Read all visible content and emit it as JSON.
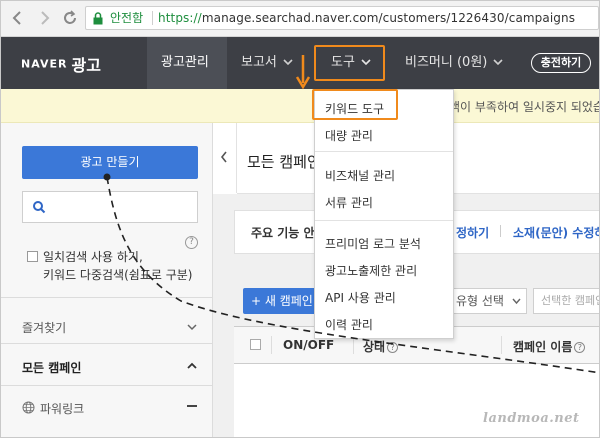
{
  "browser": {
    "security_label": "안전함",
    "url_scheme": "https://",
    "url_rest": "manage.searchad.naver.com/customers/1226430/campaigns",
    "icons": [
      "back-icon",
      "forward-icon",
      "refresh-icon",
      "lock-icon"
    ]
  },
  "topnav": {
    "logo_brand": "NAVER",
    "logo_service": "광고",
    "menu": [
      {
        "label": "광고관리"
      },
      {
        "label": "보고서"
      },
      {
        "label": "도구"
      },
      {
        "label": "비즈머니 (0원)"
      }
    ],
    "charge_button": "충전하기",
    "accent_color": "#f08a1c"
  },
  "notice": {
    "text": "액이 부족하여 일시중지 되었습"
  },
  "tools_menu": {
    "items": [
      {
        "label": "키워드 도구"
      },
      {
        "label": "대량 관리"
      },
      {
        "label": "비즈채널 관리"
      },
      {
        "label": "서류 관리"
      },
      {
        "label": "프리미엄 로그 분석"
      },
      {
        "label": "광고노출제한 관리"
      },
      {
        "label": "API 사용 관리"
      },
      {
        "label": "이력 관리"
      }
    ]
  },
  "sidebar": {
    "create_button": "광고 만들기",
    "search_placeholder": "",
    "exact_match_line1": "일치검색 사용 하기,",
    "exact_match_line2": "키워드 다중검색(쉼표로 구분)",
    "help": "?",
    "favorites": "즐겨찾기",
    "all_campaigns": "모든 캠페인",
    "powerlink": "파워링크"
  },
  "main": {
    "title": "모든 캠페인",
    "func_title": "주요 기능 안",
    "func_link1": "정하기",
    "func_link2": "소재(문안) 수정하",
    "new_campaign": "+ 새 캠페인",
    "type_select": "유형 선택",
    "campaign_select": "선택한 캠페인",
    "table_headers": [
      "ON/OFF",
      "상태",
      "캠페인 이름"
    ]
  },
  "watermark": "landmoa.net"
}
